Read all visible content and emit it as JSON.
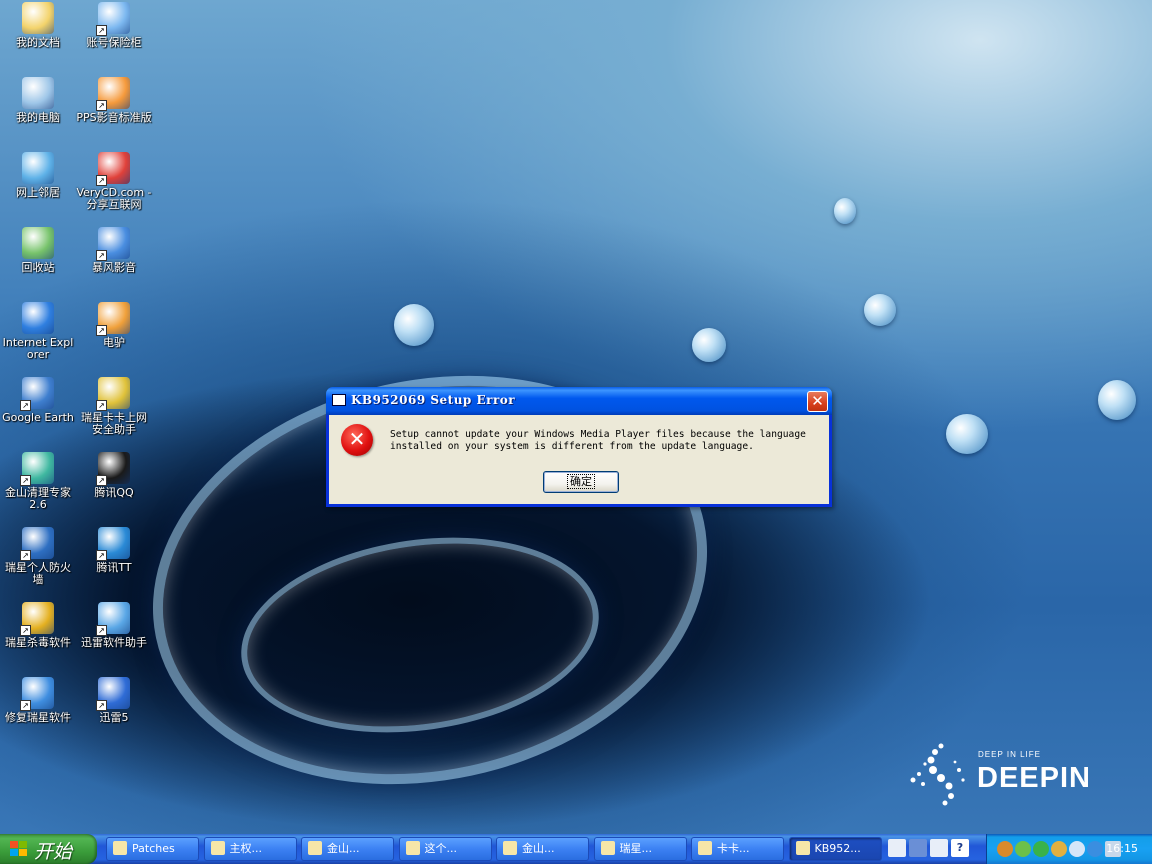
{
  "desktop": {
    "icons": [
      {
        "label": "我的文档",
        "icon": "my-documents-icon"
      },
      {
        "label": "账号保险柜",
        "icon": "account-vault-icon"
      },
      {
        "label": "我的电脑",
        "icon": "my-computer-icon"
      },
      {
        "label": "PPS影音标准版",
        "icon": "pps-player-icon"
      },
      {
        "label": "网上邻居",
        "icon": "network-places-icon"
      },
      {
        "label": "VeryCD.com - 分享互联网",
        "icon": "verycd-icon"
      },
      {
        "label": "回收站",
        "icon": "recycle-bin-icon"
      },
      {
        "label": "暴风影音",
        "icon": "baofeng-player-icon"
      },
      {
        "label": "Internet Explorer",
        "icon": "internet-explorer-icon"
      },
      {
        "label": "电驴",
        "icon": "emule-icon"
      },
      {
        "label": "Google Earth",
        "icon": "google-earth-icon"
      },
      {
        "label": "瑞星卡卡上网安全助手",
        "icon": "rising-kaka-icon"
      },
      {
        "label": "金山清理专家2.6",
        "icon": "kingsoft-cleaner-icon"
      },
      {
        "label": "腾讯QQ",
        "icon": "tencent-qq-icon"
      },
      {
        "label": "瑞星个人防火墙",
        "icon": "rising-firewall-icon"
      },
      {
        "label": "腾讯TT",
        "icon": "tencent-tt-icon"
      },
      {
        "label": "瑞星杀毒软件",
        "icon": "rising-antivirus-icon"
      },
      {
        "label": "迅雷软件助手",
        "icon": "thunder-assistant-icon"
      },
      {
        "label": "修复瑞星软件",
        "icon": "repair-rising-icon"
      },
      {
        "label": "迅雷5",
        "icon": "thunder5-icon"
      }
    ],
    "logo": {
      "small": "DEEP IN LIFE",
      "big": "DEEPIN"
    }
  },
  "dialog": {
    "title": "KB952069 Setup Error",
    "close_label": "✕",
    "message_line1": "Setup cannot update your Windows Media Player files because the language",
    "message_line2": "installed on your system is different from the update language.",
    "ok_label": "确定",
    "error_icon_glyph": "✕"
  },
  "taskbar": {
    "start_label": "开始",
    "tasks": [
      {
        "label": "Patches",
        "icon": "folder-icon"
      },
      {
        "label": "主权...",
        "icon": "word-doc-icon"
      },
      {
        "label": "金山...",
        "icon": "kingsoft-icon"
      },
      {
        "label": "这个...",
        "icon": "ie-page-icon"
      },
      {
        "label": "金山...",
        "icon": "kingsoft-2-icon"
      },
      {
        "label": "瑞星...",
        "icon": "rising-icon"
      },
      {
        "label": "卡卡...",
        "icon": "kaka-icon"
      },
      {
        "label": "KB952...",
        "icon": "setup-icon"
      }
    ],
    "quick": [
      "keyboard-icon",
      "pen-icon",
      "ime-icon",
      "help-icon"
    ],
    "help_glyph": "?",
    "clock": "16:15"
  },
  "colors": {
    "dialog_border": "#0831d9",
    "taskbar": "#2157d7",
    "start": "#3a9c3a",
    "tray": "#18a1f2"
  }
}
